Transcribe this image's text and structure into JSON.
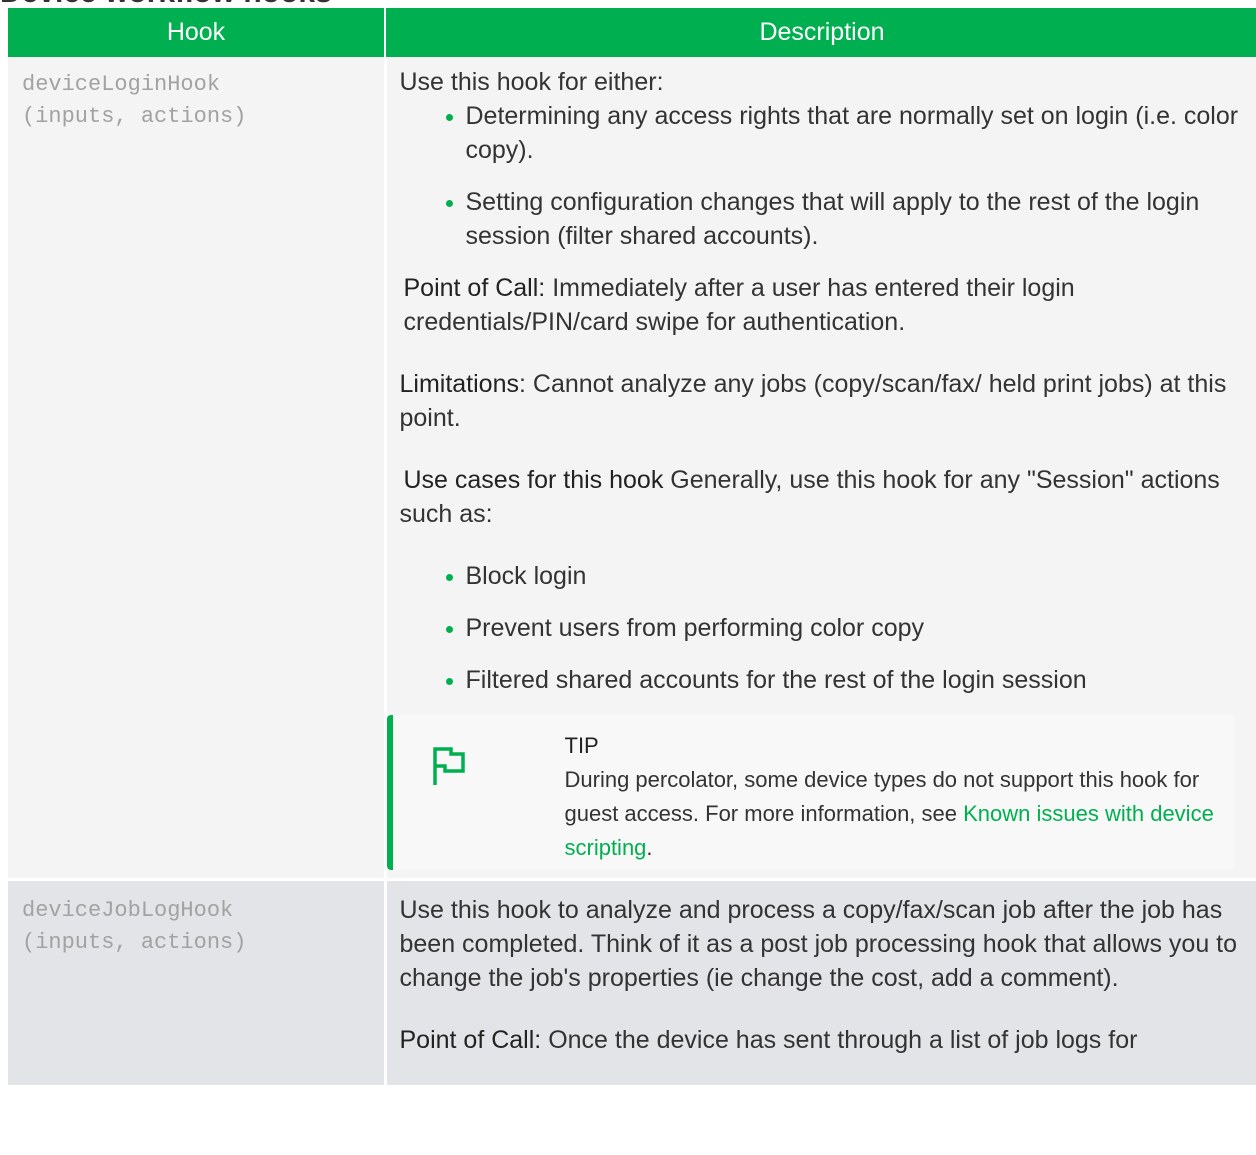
{
  "section_heading": "Device workflow hooks",
  "table": {
    "headers": {
      "hook": "Hook",
      "description": "Description"
    },
    "rows": [
      {
        "hook_line1": "deviceLoginHook",
        "hook_line2": "(inputs, actions)",
        "intro": "Use this hook for either:",
        "bullets": [
          "Determining any access rights that are normally set on login (i.e. color copy).",
          "Setting configuration changes that will apply to the rest of the login session (filter shared accounts)."
        ],
        "point_of_call_label": "Point of Call:",
        "point_of_call_text": " Immediately after a user has entered their login credentials/PIN/card swipe for authentication.",
        "limitations_label": "Limitations",
        "limitations_text": ": Cannot analyze any jobs (copy/scan/fax/ held print jobs) at this point.",
        "use_cases_label": "Use cases for this hook",
        "use_cases_text": " Generally, use this hook for any \"Session\" actions such as:",
        "use_case_bullets": [
          "Block login",
          "Prevent users from performing color copy",
          "Filtered shared accounts for the rest of the login session"
        ],
        "tip": {
          "icon": "flag-icon",
          "title": "TIP",
          "text": "During percolator, some device types do not support this hook for guest access. For more information, see ",
          "link": "Known issues with device scripting",
          "end": "."
        }
      },
      {
        "hook_line1": "deviceJobLogHook",
        "hook_line2": "(inputs, actions)",
        "intro": "Use this hook to analyze and process a copy/fax/scan job after the job has been completed. Think of it as a post job processing hook that allows you to change the job's properties (ie change the cost, add a comment).",
        "point_of_call_label": "Point of Call:",
        "point_of_call_text": " Once the device has sent through a list of job logs for"
      }
    ]
  },
  "colors": {
    "accent": "#00b050",
    "row_a": "#f4f4f4",
    "row_b": "#e2e4e7"
  }
}
